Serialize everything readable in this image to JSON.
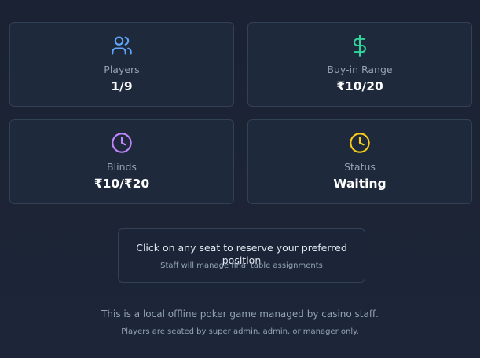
{
  "cards": {
    "players": {
      "icon": "users-icon",
      "label": "Players",
      "value": "1/9",
      "color": "#60a5fa"
    },
    "buyin": {
      "icon": "dollar-icon",
      "label": "Buy-in Range",
      "value": "₹10/20",
      "color": "#34d399"
    },
    "blinds": {
      "icon": "clock-icon",
      "label": "Blinds",
      "value": "₹10/₹20",
      "color": "#c084fc"
    },
    "status": {
      "icon": "clock-icon",
      "label": "Status",
      "value": "Waiting",
      "color": "#facc15"
    }
  },
  "notice": {
    "main": "Click on any seat to reserve your preferred position",
    "sub": "Staff will manage final table assignments"
  },
  "footer": {
    "line1": "This is a local offline poker game managed by casino staff.",
    "line2": "Players are seated by super admin, admin, or manager only."
  }
}
